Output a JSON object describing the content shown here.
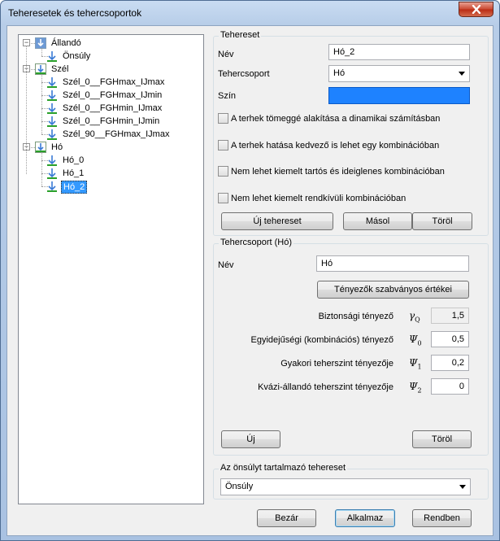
{
  "window": {
    "title": "Teheresetek és tehercsoportok"
  },
  "tree": {
    "groups": [
      {
        "label": "Állandó",
        "icon": "load-case-permanent-icon",
        "children": [
          "Önsúly"
        ]
      },
      {
        "label": "Szél",
        "icon": "load-case-variable-icon",
        "children": [
          "Szél_0__FGHmax_IJmax",
          "Szél_0__FGHmax_IJmin",
          "Szél_0__FGHmin_IJmax",
          "Szél_0__FGHmin_IJmin",
          "Szél_90__FGHmax_IJmax"
        ]
      },
      {
        "label": "Hó",
        "icon": "load-case-variable-icon",
        "children": [
          "Hó_0",
          "Hó_1",
          "Hó_2"
        ]
      }
    ],
    "selected": "Hó_2"
  },
  "teher": {
    "group_title": "Tehereset",
    "name_label": "Név",
    "name_value": "Hó_2",
    "group_label": "Tehercsoport",
    "group_value": "Hó",
    "color_label": "Szín",
    "color_value": "#1e82ff",
    "checks": [
      "A terhek tömeggé alakítása a dinamikai számításban",
      "A terhek hatása kedvező is lehet egy kombinációban",
      "Nem lehet kiemelt tartós és ideiglenes kombinációban",
      "Nem lehet kiemelt rendkívüli kombinációban"
    ],
    "new_button": "Új tehereset",
    "copy_button": "Másol",
    "delete_button": "Töröl"
  },
  "tercsop": {
    "group_title": "Tehercsoport (Hó)",
    "name_label": "Név",
    "name_value": "Hó",
    "defaults_button": "Tényezők szabványos értékei",
    "factors": [
      {
        "label": "Biztonsági tényező",
        "symbol": "γ",
        "sub": "Q",
        "value": "1,5",
        "readonly": true
      },
      {
        "label": "Egyidejűségi (kombinációs) tényező",
        "symbol": "Ψ",
        "sub": "0",
        "value": "0,5",
        "readonly": false
      },
      {
        "label": "Gyakori teherszint tényezője",
        "symbol": "Ψ",
        "sub": "1",
        "value": "0,2",
        "readonly": false
      },
      {
        "label": "Kvázi-állandó teherszint tényezője",
        "symbol": "Ψ",
        "sub": "2",
        "value": "0",
        "readonly": false
      }
    ],
    "new_button": "Új",
    "delete_button": "Töröl"
  },
  "selfweight": {
    "group_title": "Az önsúlyt tartalmazó tehereset",
    "value": "Önsúly"
  },
  "footer": {
    "close_button": "Bezár",
    "apply_button": "Alkalmaz",
    "ok_button": "Rendben"
  }
}
